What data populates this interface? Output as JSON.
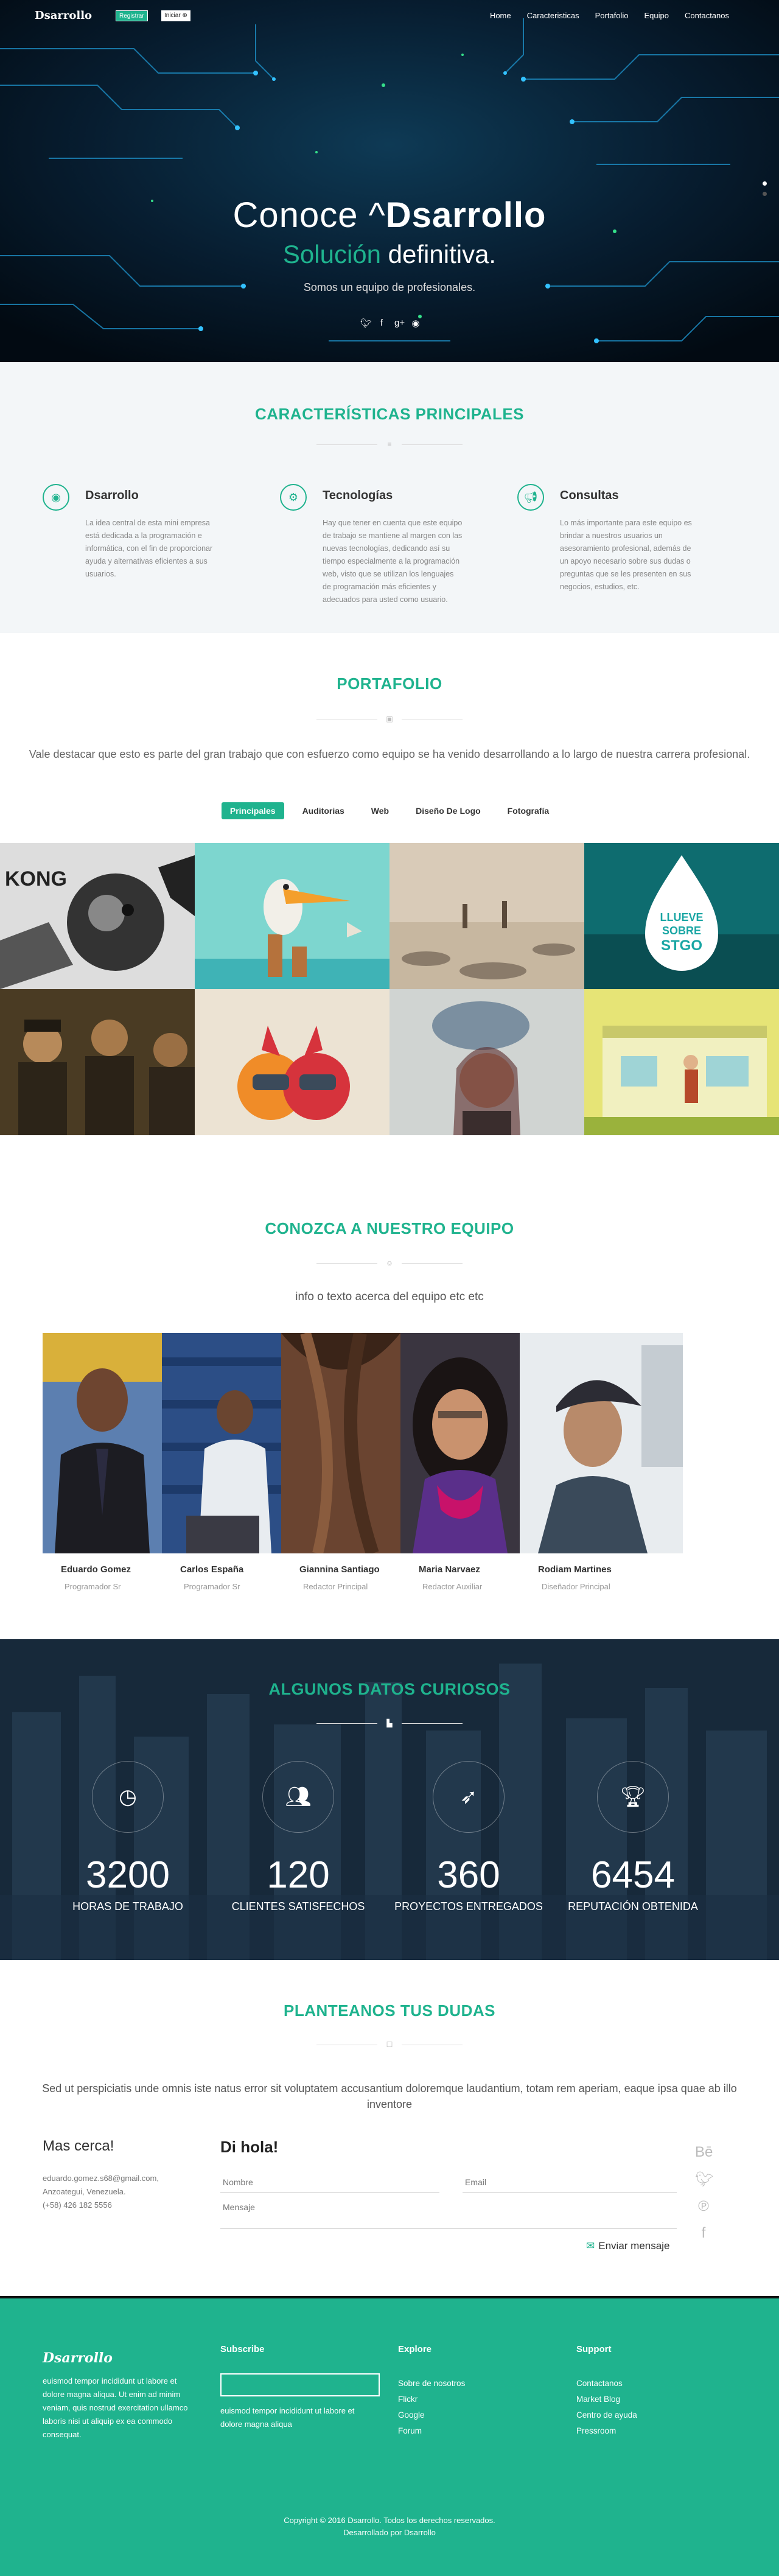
{
  "nav": {
    "brand": "Dsarrollo",
    "register": "Registrar",
    "login": "Iniciar ⊕",
    "menu": [
      "Home",
      "Caracteristicas",
      "Portafolio",
      "Equipo",
      "Contactanos"
    ]
  },
  "hero": {
    "line1_a": "Conoce ^",
    "line1_b": "Dsarrollo",
    "line2_a": "Solución",
    "line2_b": " definitiva.",
    "tagline": "Somos un equipo de profesionales.",
    "social_icons": [
      "twitter-icon",
      "facebook-icon",
      "google-plus-icon",
      "github-icon"
    ]
  },
  "features": {
    "title": "CARACTERÍSTICAS PRINCIPALES",
    "items": [
      {
        "icon": "github-icon",
        "title": "Dsarrollo",
        "text": "La idea central de esta mini empresa está dedicada a la programación e informática, con el fin de proporcionar ayuda y alternativas eficientes a sus usuarios."
      },
      {
        "icon": "tech-icon",
        "title": "Tecnologías",
        "text": "Hay que tener en cuenta que este equipo de trabajo se mantiene al margen con las nuevas tecnologías, dedicando así su tiempo especialmente a la programación web, visto que se utilizan los lenguajes de programación más eficientes y adecuados para usted como usuario."
      },
      {
        "icon": "megaphone-icon",
        "title": "Consultas",
        "text": "Lo más importante para este equipo es brindar a nuestros usuarios un asesoramiento profesional, además de un apoyo necesario sobre sus dudas o preguntas que se les presenten en sus negocios, estudios, etc."
      }
    ]
  },
  "portfolio": {
    "title": "PORTAFOLIO",
    "text": "Vale destacar que esto es parte del gran trabajo que con esfuerzo como equipo se ha venido desarrollando a lo largo de nuestra carrera profesional.",
    "filters": [
      "Principales",
      "Auditorias",
      "Web",
      "Diseño De Logo",
      "Fotografía"
    ],
    "active_filter": "Principales",
    "drop_text": [
      "LLUEVE",
      "SOBRE",
      "STGO"
    ],
    "kong_text": "KONG"
  },
  "team": {
    "title": "CONOZCA A NUESTRO EQUIPO",
    "subtitle": "info o texto acerca del equipo etc etc",
    "members": [
      {
        "name": "Eduardo Gomez",
        "role": "Programador Sr"
      },
      {
        "name": "Carlos España",
        "role": "Programador Sr"
      },
      {
        "name": "Giannina Santiago",
        "role": "Redactor Principal"
      },
      {
        "name": "Maria Narvaez",
        "role": "Redactor Auxiliar"
      },
      {
        "name": "Rodiam Martines",
        "role": "Diseñador Principal"
      }
    ]
  },
  "stats": {
    "title": "ALGUNOS DATOS CURIOSOS",
    "items": [
      {
        "icon": "clock-icon",
        "number": "3200",
        "label": "HORAS DE TRABAJO"
      },
      {
        "icon": "users-icon",
        "number": "120",
        "label": "CLIENTES SATISFECHOS"
      },
      {
        "icon": "rocket-icon",
        "number": "360",
        "label": "PROYECTOS ENTREGADOS"
      },
      {
        "icon": "trophy-icon",
        "number": "6454",
        "label": "REPUTACIÓN OBTENIDA"
      }
    ]
  },
  "contact": {
    "title": "PLANTEANOS TUS DUDAS",
    "text": "Sed ut perspiciatis unde omnis iste natus error sit voluptatem accusantium doloremque laudantium, totam rem aperiam, eaque ipsa quae ab illo inventore",
    "left_title": "Mas cerca!",
    "email": "eduardo.gomez.s68@gmail.com,",
    "location": "Anzoategui, Venezuela.",
    "phone": "(+58) 426 182 5556",
    "form_title": "Di hola!",
    "name_placeholder": "Nombre",
    "email_placeholder": "Email",
    "message_placeholder": "Mensaje",
    "send": "Enviar mensaje",
    "side_icons": [
      "behance-icon",
      "twitter-icon",
      "pinterest-icon",
      "facebook-icon"
    ]
  },
  "footer": {
    "brand": "Dsarrollo",
    "about": "euismod tempor incididunt ut labore et dolore magna aliqua. Ut enim ad minim veniam, quis nostrud exercitation ullamco laboris nisi ut aliquip ex ea commodo consequat.",
    "subscribe_title": "Subscribe",
    "subscribe_text": "euismod tempor incididunt ut labore et dolore magna aliqua",
    "explore_title": "Explore",
    "explore": [
      "Sobre de nosotros",
      "Flickr",
      "Google",
      "Forum"
    ],
    "support_title": "Support",
    "support": [
      "Contactanos",
      "Market Blog",
      "Centro de ayuda",
      "Pressroom"
    ],
    "copyright": "Copyright © 2016 Dsarrollo. Todos los derechos reservados.",
    "credits": "Desarrollado por Dsarrollo"
  }
}
